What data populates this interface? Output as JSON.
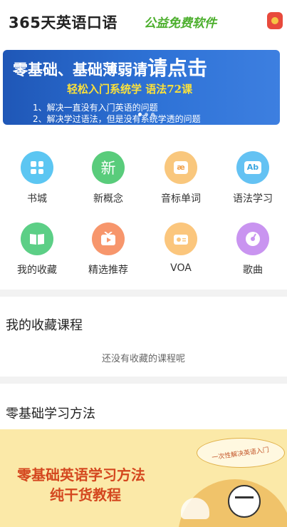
{
  "header": {
    "title": "365天英语口语",
    "slogan": "公益免费软件",
    "gift_icon": "gift-icon"
  },
  "banner": {
    "line1a": "零基础、基础薄弱请",
    "line1b": "请点击",
    "line2": "轻松入门系统学  语法72课",
    "point1": "1、解决一直没有入门英语的问题",
    "point2": "2、解决学过语法，但是没有系统学透的问题"
  },
  "grid": [
    {
      "label": "书城",
      "icon": "bookstore-icon",
      "color": "#5cc6f2"
    },
    {
      "label": "新概念",
      "icon": "new-concept-icon",
      "color": "#59cc7b",
      "glyph": "新"
    },
    {
      "label": "音标单词",
      "icon": "phonetic-icon",
      "color": "#f9c77d",
      "glyph": "æ"
    },
    {
      "label": "语法学习",
      "icon": "grammar-icon",
      "color": "#64c2f3",
      "glyph": "Ab"
    },
    {
      "label": "我的收藏",
      "icon": "favorites-book-icon",
      "color": "#5ccf86"
    },
    {
      "label": "精选推荐",
      "icon": "tv-recommend-icon",
      "color": "#f7966c"
    },
    {
      "label": "VOA",
      "icon": "radio-icon",
      "color": "#fbc67d"
    },
    {
      "label": "歌曲",
      "icon": "music-disc-icon",
      "color": "#c994f0"
    }
  ],
  "favorites": {
    "title": "我的收藏课程",
    "empty": "还没有收藏的课程呢"
  },
  "method": {
    "title": "零基础学习方法",
    "banner_line1": "零基础英语学习方法",
    "banner_line2": "纯干货教程",
    "bubble": "一次性解决英语入门"
  }
}
